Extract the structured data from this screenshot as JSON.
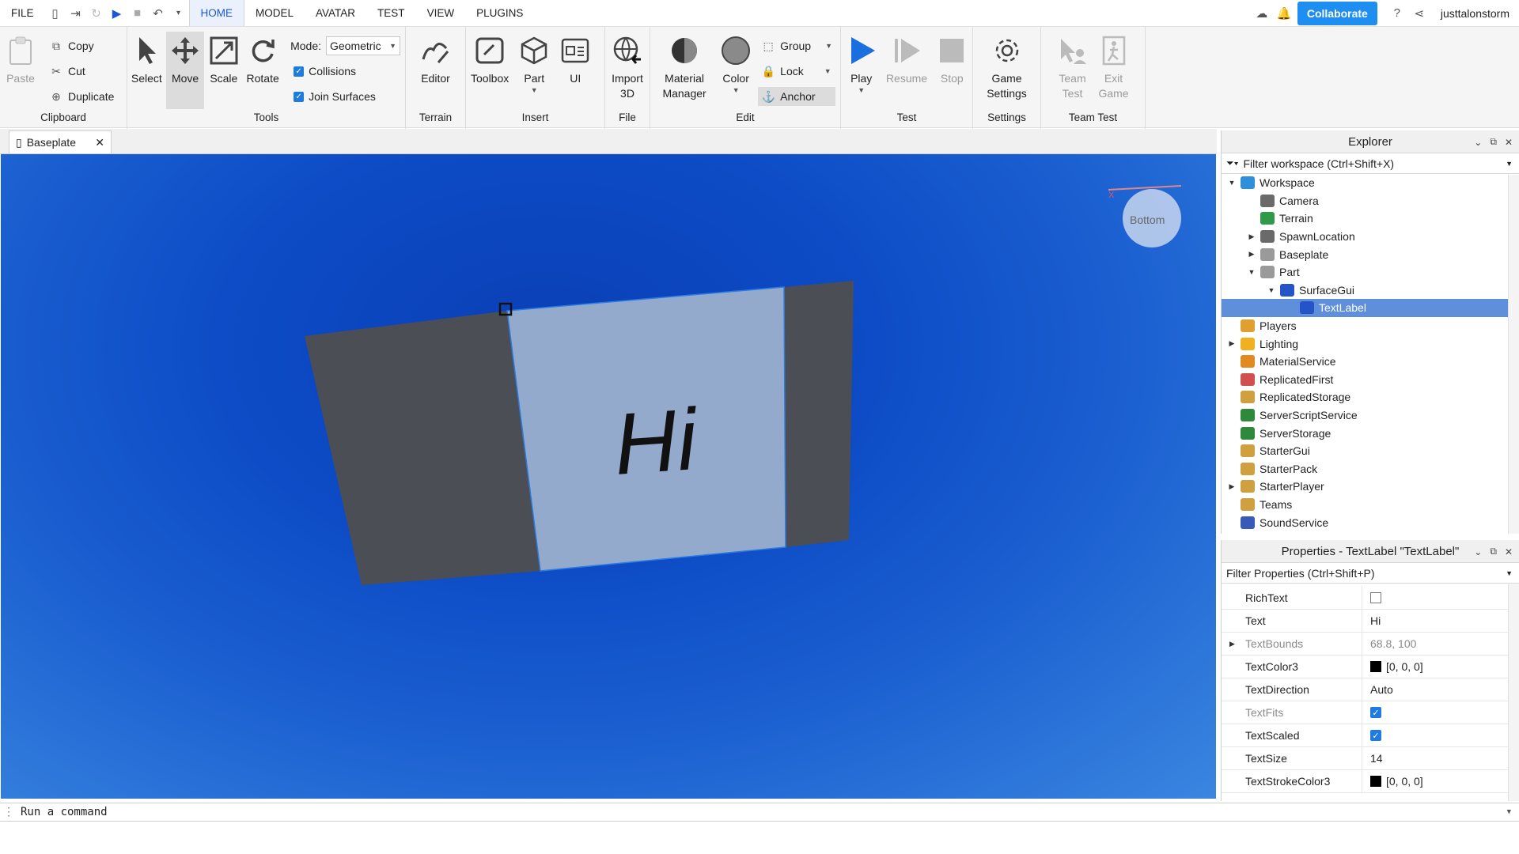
{
  "menubar": {
    "items": [
      "FILE",
      "HOME",
      "MODEL",
      "AVATAR",
      "TEST",
      "VIEW",
      "PLUGINS"
    ],
    "active": "HOME",
    "collaborate_label": "Collaborate",
    "username": "justtalonstorm"
  },
  "ribbon": {
    "clipboard": {
      "label": "Clipboard",
      "paste": "Paste",
      "copy": "Copy",
      "cut": "Cut",
      "duplicate": "Duplicate"
    },
    "tools": {
      "label": "Tools",
      "select": "Select",
      "move": "Move",
      "scale": "Scale",
      "rotate": "Rotate",
      "mode_label": "Mode:",
      "mode_value": "Geometric",
      "collisions": "Collisions",
      "join_surfaces": "Join Surfaces"
    },
    "terrain": {
      "label": "Terrain",
      "editor": "Editor"
    },
    "insert": {
      "label": "Insert",
      "toolbox": "Toolbox",
      "part": "Part",
      "ui": "UI"
    },
    "file": {
      "label": "File",
      "import3d": "Import 3D"
    },
    "edit": {
      "label": "Edit",
      "material_manager": "Material Manager",
      "color": "Color",
      "group": "Group",
      "lock": "Lock",
      "anchor": "Anchor"
    },
    "test": {
      "label": "Test",
      "play": "Play",
      "resume": "Resume",
      "stop": "Stop"
    },
    "settings": {
      "label": "Settings",
      "game_settings": "Game Settings"
    },
    "team_test": {
      "label": "Team Test",
      "team_test": "Team Test",
      "exit_game": "Exit Game"
    }
  },
  "document_tab": {
    "title": "Baseplate"
  },
  "viewport": {
    "label_text": "Hi",
    "view_cube_face": "Bottom",
    "axis_letter": "X"
  },
  "explorer": {
    "title": "Explorer",
    "filter_placeholder": "Filter workspace (Ctrl+Shift+X)",
    "tree": [
      {
        "label": "Workspace",
        "depth": 0,
        "arrow": "open",
        "icon_color": "#2f8fd8"
      },
      {
        "label": "Camera",
        "depth": 1,
        "arrow": "none",
        "icon_color": "#6a6a6a"
      },
      {
        "label": "Terrain",
        "depth": 1,
        "arrow": "none",
        "icon_color": "#2e9a4a"
      },
      {
        "label": "SpawnLocation",
        "depth": 1,
        "arrow": "closed",
        "icon_color": "#6a6a6a"
      },
      {
        "label": "Baseplate",
        "depth": 1,
        "arrow": "closed",
        "icon_color": "#9a9a9a"
      },
      {
        "label": "Part",
        "depth": 1,
        "arrow": "open",
        "icon_color": "#9a9a9a"
      },
      {
        "label": "SurfaceGui",
        "depth": 2,
        "arrow": "open",
        "icon_color": "#2454c8"
      },
      {
        "label": "TextLabel",
        "depth": 3,
        "arrow": "none",
        "icon_color": "#2454c8",
        "selected": true
      },
      {
        "label": "Players",
        "depth": 0,
        "arrow": "none",
        "icon_color": "#e0a030"
      },
      {
        "label": "Lighting",
        "depth": 0,
        "arrow": "closed",
        "icon_color": "#f0b020"
      },
      {
        "label": "MaterialService",
        "depth": 0,
        "arrow": "none",
        "icon_color": "#e08a20"
      },
      {
        "label": "ReplicatedFirst",
        "depth": 0,
        "arrow": "none",
        "icon_color": "#d05050"
      },
      {
        "label": "ReplicatedStorage",
        "depth": 0,
        "arrow": "none",
        "icon_color": "#d0a040"
      },
      {
        "label": "ServerScriptService",
        "depth": 0,
        "arrow": "none",
        "icon_color": "#2e8a3a"
      },
      {
        "label": "ServerStorage",
        "depth": 0,
        "arrow": "none",
        "icon_color": "#2e8a3a"
      },
      {
        "label": "StarterGui",
        "depth": 0,
        "arrow": "none",
        "icon_color": "#d0a040"
      },
      {
        "label": "StarterPack",
        "depth": 0,
        "arrow": "none",
        "icon_color": "#d0a040"
      },
      {
        "label": "StarterPlayer",
        "depth": 0,
        "arrow": "closed",
        "icon_color": "#d0a040"
      },
      {
        "label": "Teams",
        "depth": 0,
        "arrow": "none",
        "icon_color": "#d0a040"
      },
      {
        "label": "SoundService",
        "depth": 0,
        "arrow": "none",
        "icon_color": "#3a5ab8"
      }
    ]
  },
  "properties": {
    "title": "Properties - TextLabel \"TextLabel\"",
    "filter_placeholder": "Filter Properties (Ctrl+Shift+P)",
    "rows": [
      {
        "name": "RichText",
        "type": "checkbox",
        "checked": false
      },
      {
        "name": "Text",
        "type": "text",
        "value": "Hi"
      },
      {
        "name": "TextBounds",
        "type": "text",
        "value": "68.8, 100",
        "dim": true,
        "expandable": true
      },
      {
        "name": "TextColor3",
        "type": "color",
        "value": "[0, 0, 0]",
        "color": "#000000"
      },
      {
        "name": "TextDirection",
        "type": "text",
        "value": "Auto"
      },
      {
        "name": "TextFits",
        "type": "checkbox",
        "checked": true,
        "dim": true
      },
      {
        "name": "TextScaled",
        "type": "checkbox",
        "checked": true
      },
      {
        "name": "TextSize",
        "type": "text",
        "value": "14"
      },
      {
        "name": "TextStrokeColor3",
        "type": "color",
        "value": "[0, 0, 0]",
        "color": "#000000"
      }
    ]
  },
  "command_bar": {
    "placeholder": "Run a command"
  },
  "colors": {
    "accent": "#1f8ef1",
    "selection": "#5f8fda",
    "viewport_blue": "#0d4cc6"
  }
}
